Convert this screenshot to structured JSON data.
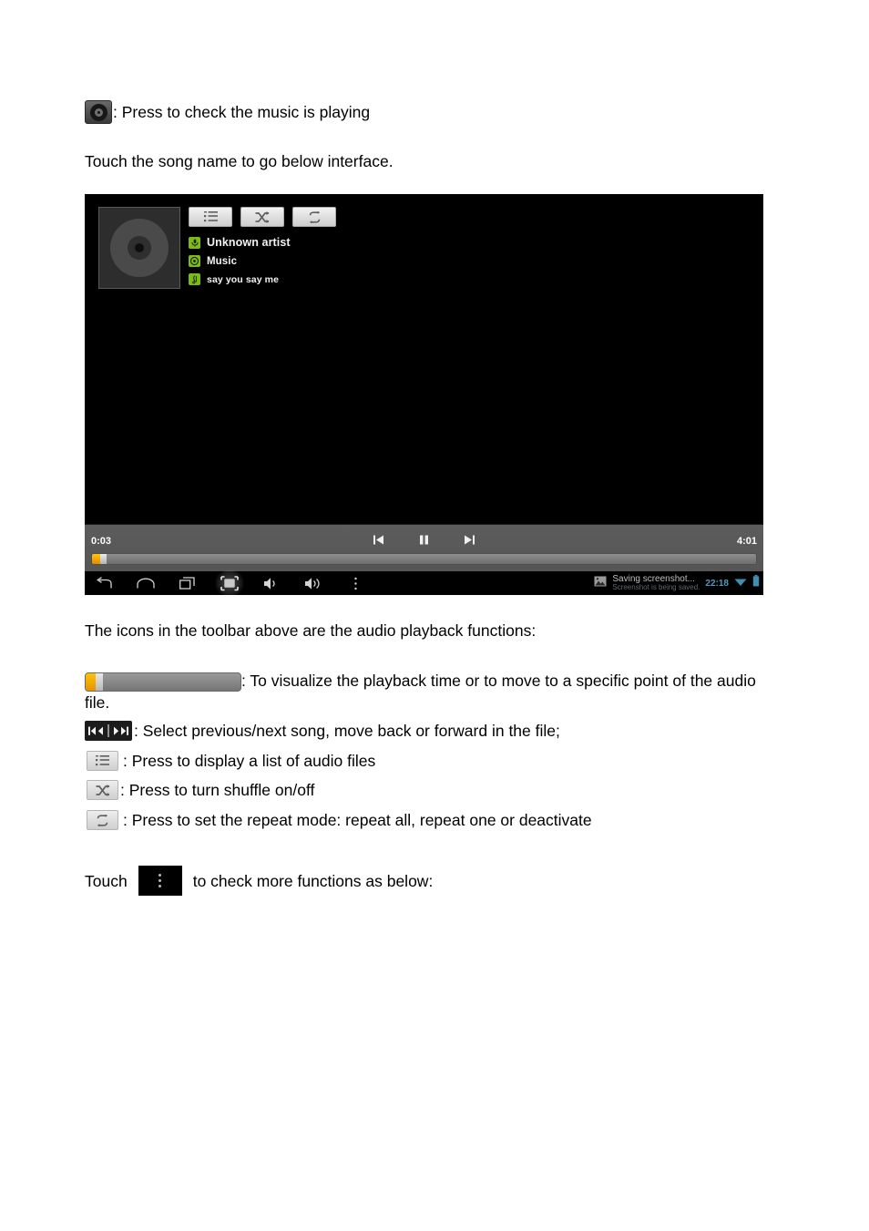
{
  "document": {
    "line1": {
      "icon": "music-disc-icon",
      "text": ": Press to check the music is playing"
    },
    "line2": "Touch the song name to go below interface.",
    "line3": "The icons in the toolbar above are the audio playback functions:",
    "bullets": [
      {
        "icon": "seekbar-icon",
        "text": ": To visualize the playback time or to move to a specific point of the audio file."
      },
      {
        "icon": "prev-next-icon",
        "text": ":  Select previous/next song, move back or forward in the file;"
      },
      {
        "icon": "playlist-icon",
        "text": ": Press to display a list of audio files"
      },
      {
        "icon": "shuffle-icon",
        "text": ": Press to turn shuffle on/off"
      },
      {
        "icon": "repeat-icon",
        "text": ": Press to set the repeat mode: repeat all, repeat one or deactivate"
      }
    ],
    "closing": {
      "before": "Touch",
      "icon": "overflow-menu-icon",
      "after": "to check more functions as below:"
    }
  },
  "device": {
    "player": {
      "album_art_icon": "vinyl-record-icon",
      "toolbar_buttons": [
        {
          "name": "playlist-button",
          "icon": "playlist-icon"
        },
        {
          "name": "shuffle-button",
          "icon": "shuffle-icon"
        },
        {
          "name": "repeat-button",
          "icon": "repeat-icon"
        }
      ],
      "metadata": [
        {
          "icon": "artist-icon",
          "label": "Unknown artist"
        },
        {
          "icon": "album-icon",
          "label": "Music"
        },
        {
          "icon": "track-icon",
          "label": "say you say me"
        }
      ],
      "accent_green": "#7bbb16"
    },
    "controls": {
      "elapsed": "0:03",
      "duration": "4:01",
      "previous_icon": "skip-previous-icon",
      "play_pause_icon": "pause-icon",
      "next_icon": "skip-next-icon",
      "progress_percent": 1,
      "seek_fill_color": "#ffc40a"
    },
    "navbar": {
      "buttons": [
        {
          "name": "back-button",
          "icon": "back-icon"
        },
        {
          "name": "home-button",
          "icon": "home-icon"
        },
        {
          "name": "recent-apps-button",
          "icon": "recent-apps-icon"
        },
        {
          "name": "screenshot-button",
          "icon": "screenshot-icon"
        },
        {
          "name": "volume-down-button",
          "icon": "volume-down-icon"
        },
        {
          "name": "volume-up-button",
          "icon": "volume-up-icon"
        },
        {
          "name": "overflow-button",
          "icon": "overflow-menu-icon"
        }
      ],
      "notification": {
        "icon": "image-icon",
        "title": "Saving screenshot...",
        "subtitle": "Screenshot is being saved."
      },
      "clock": "22:18",
      "wifi_icon": "wifi-icon",
      "battery_icon": "battery-icon"
    }
  }
}
